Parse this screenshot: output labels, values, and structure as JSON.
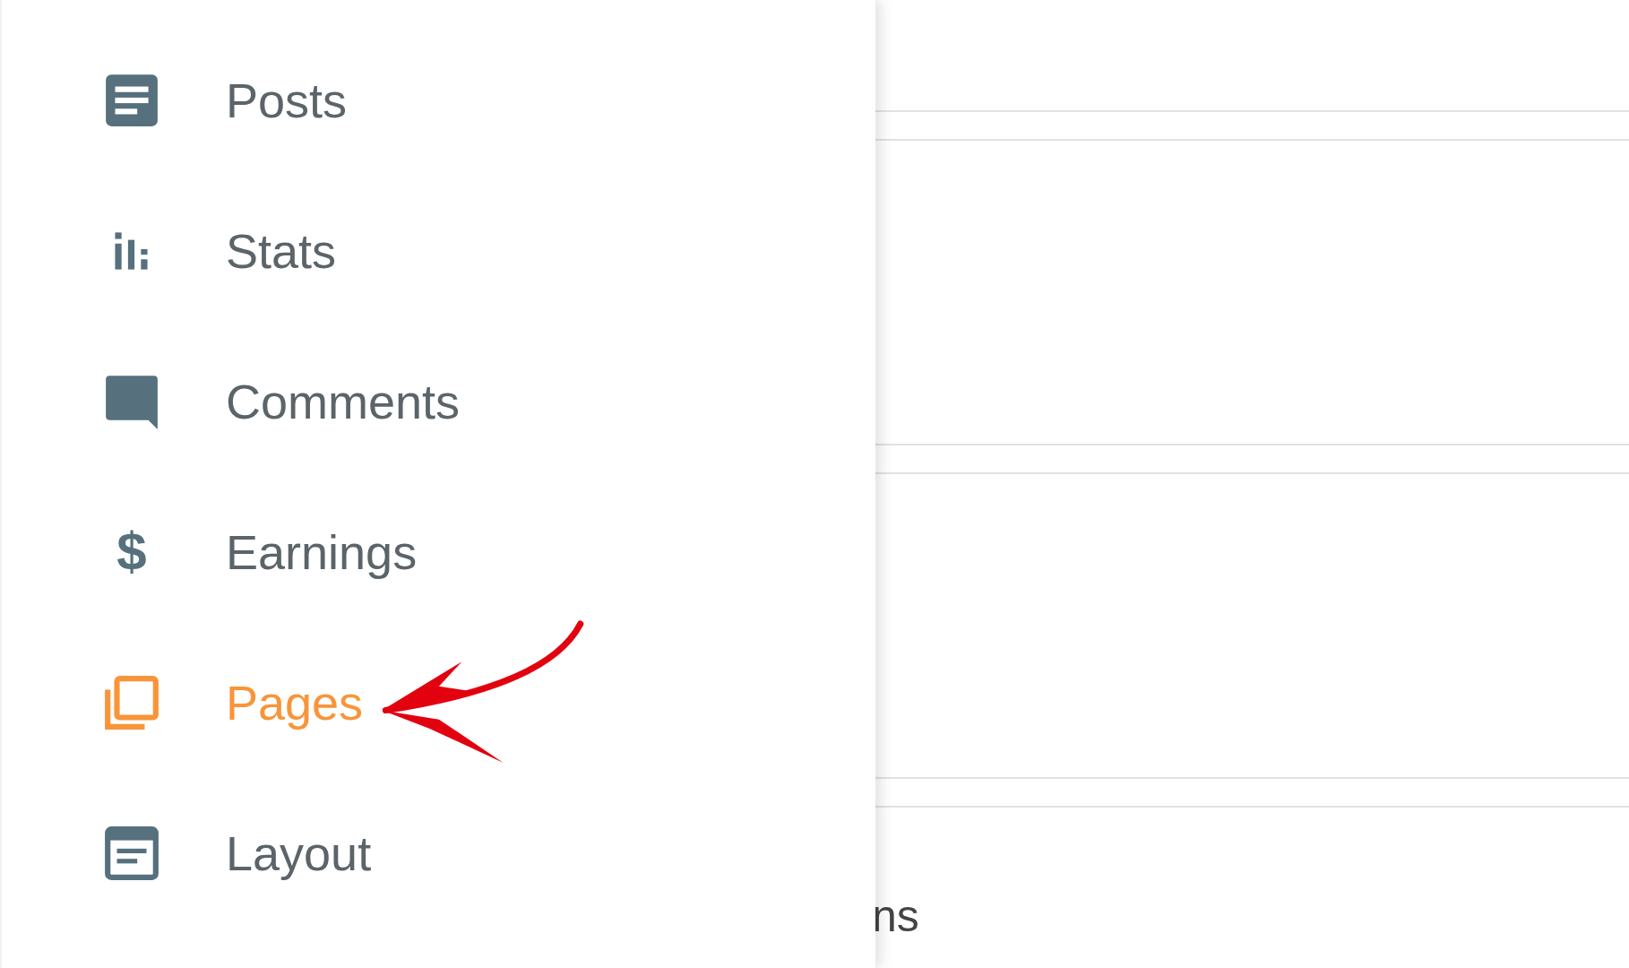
{
  "sidebar": {
    "items": [
      {
        "label": "Posts",
        "kind": "posts",
        "selected": false
      },
      {
        "label": "Stats",
        "kind": "stats",
        "selected": false
      },
      {
        "label": "Comments",
        "kind": "comments",
        "selected": false
      },
      {
        "label": "Earnings",
        "kind": "earnings",
        "glyph": "$",
        "selected": false
      },
      {
        "label": "Pages",
        "kind": "pages",
        "selected": true
      },
      {
        "label": "Layout",
        "kind": "layout",
        "selected": false
      }
    ]
  },
  "main": {
    "rows": [
      {
        "kind": "divider-row"
      },
      {
        "kind": "divider-row"
      },
      {
        "kind": "divider-row"
      }
    ],
    "partial_text": "ns"
  },
  "annotation": {
    "kind": "arrow"
  }
}
